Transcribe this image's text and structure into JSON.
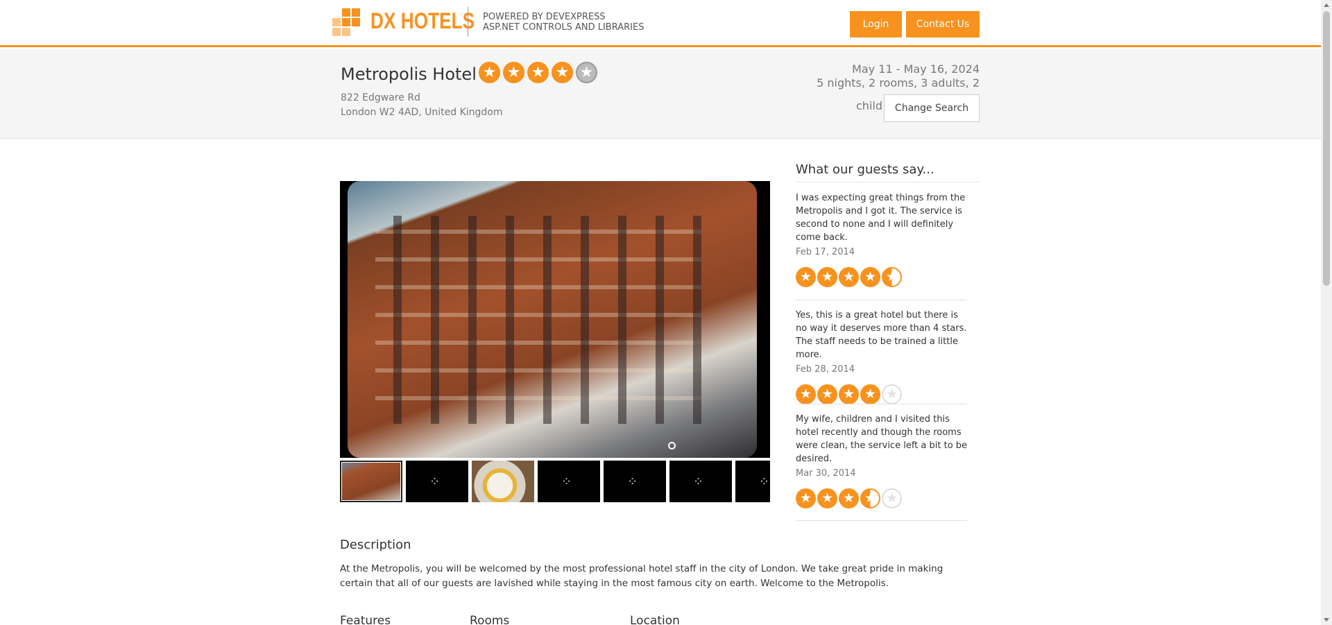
{
  "header": {
    "brand": "DX HOTELS",
    "powered_line1": "POWERED BY DEVEXPRESS",
    "powered_line2": "ASP.NET CONTROLS AND LIBRARIES",
    "login_label": "Login",
    "contact_label": "Contact Us",
    "accent_color": "#f7921e"
  },
  "hotel": {
    "name": "Metropolis Hotel",
    "rating": 4,
    "address_line1": "822 Edgware Rd",
    "address_line2": "London W2 4AD, United Kingdom"
  },
  "search": {
    "dates": "May 11 - May 16, 2024",
    "summary": "5 nights, 2 rooms, 3 adults, 2",
    "summary_end": "child",
    "change_label": "Change Search"
  },
  "reviews": {
    "title": "What our guests say...",
    "items": [
      {
        "text": "I was expecting great things from the Metropolis and I got it. The service is second to none and I will definitely come back.",
        "date": "Feb 17, 2014",
        "rating": 4.5
      },
      {
        "text": "Yes, this is a great hotel but there is no way it deserves more than 4 stars. The staff needs to be trained a little more.",
        "date": "Feb 28, 2014",
        "rating": 4
      },
      {
        "text": "My wife, children and I visited this hotel recently and though the rooms were clean, the service left a bit to be desired.",
        "date": "Mar 30, 2014",
        "rating": 3.5
      }
    ]
  },
  "description": {
    "title": "Description",
    "text": "At the Metropolis, you will be welcomed by the most professional hotel staff in the city of London. We take great pride in making certain that all of our guests are lavished while staying in the most famous city on earth. Welcome to the Metropolis."
  },
  "sections": {
    "features": "Features",
    "rooms": "Rooms",
    "location": "Location"
  }
}
